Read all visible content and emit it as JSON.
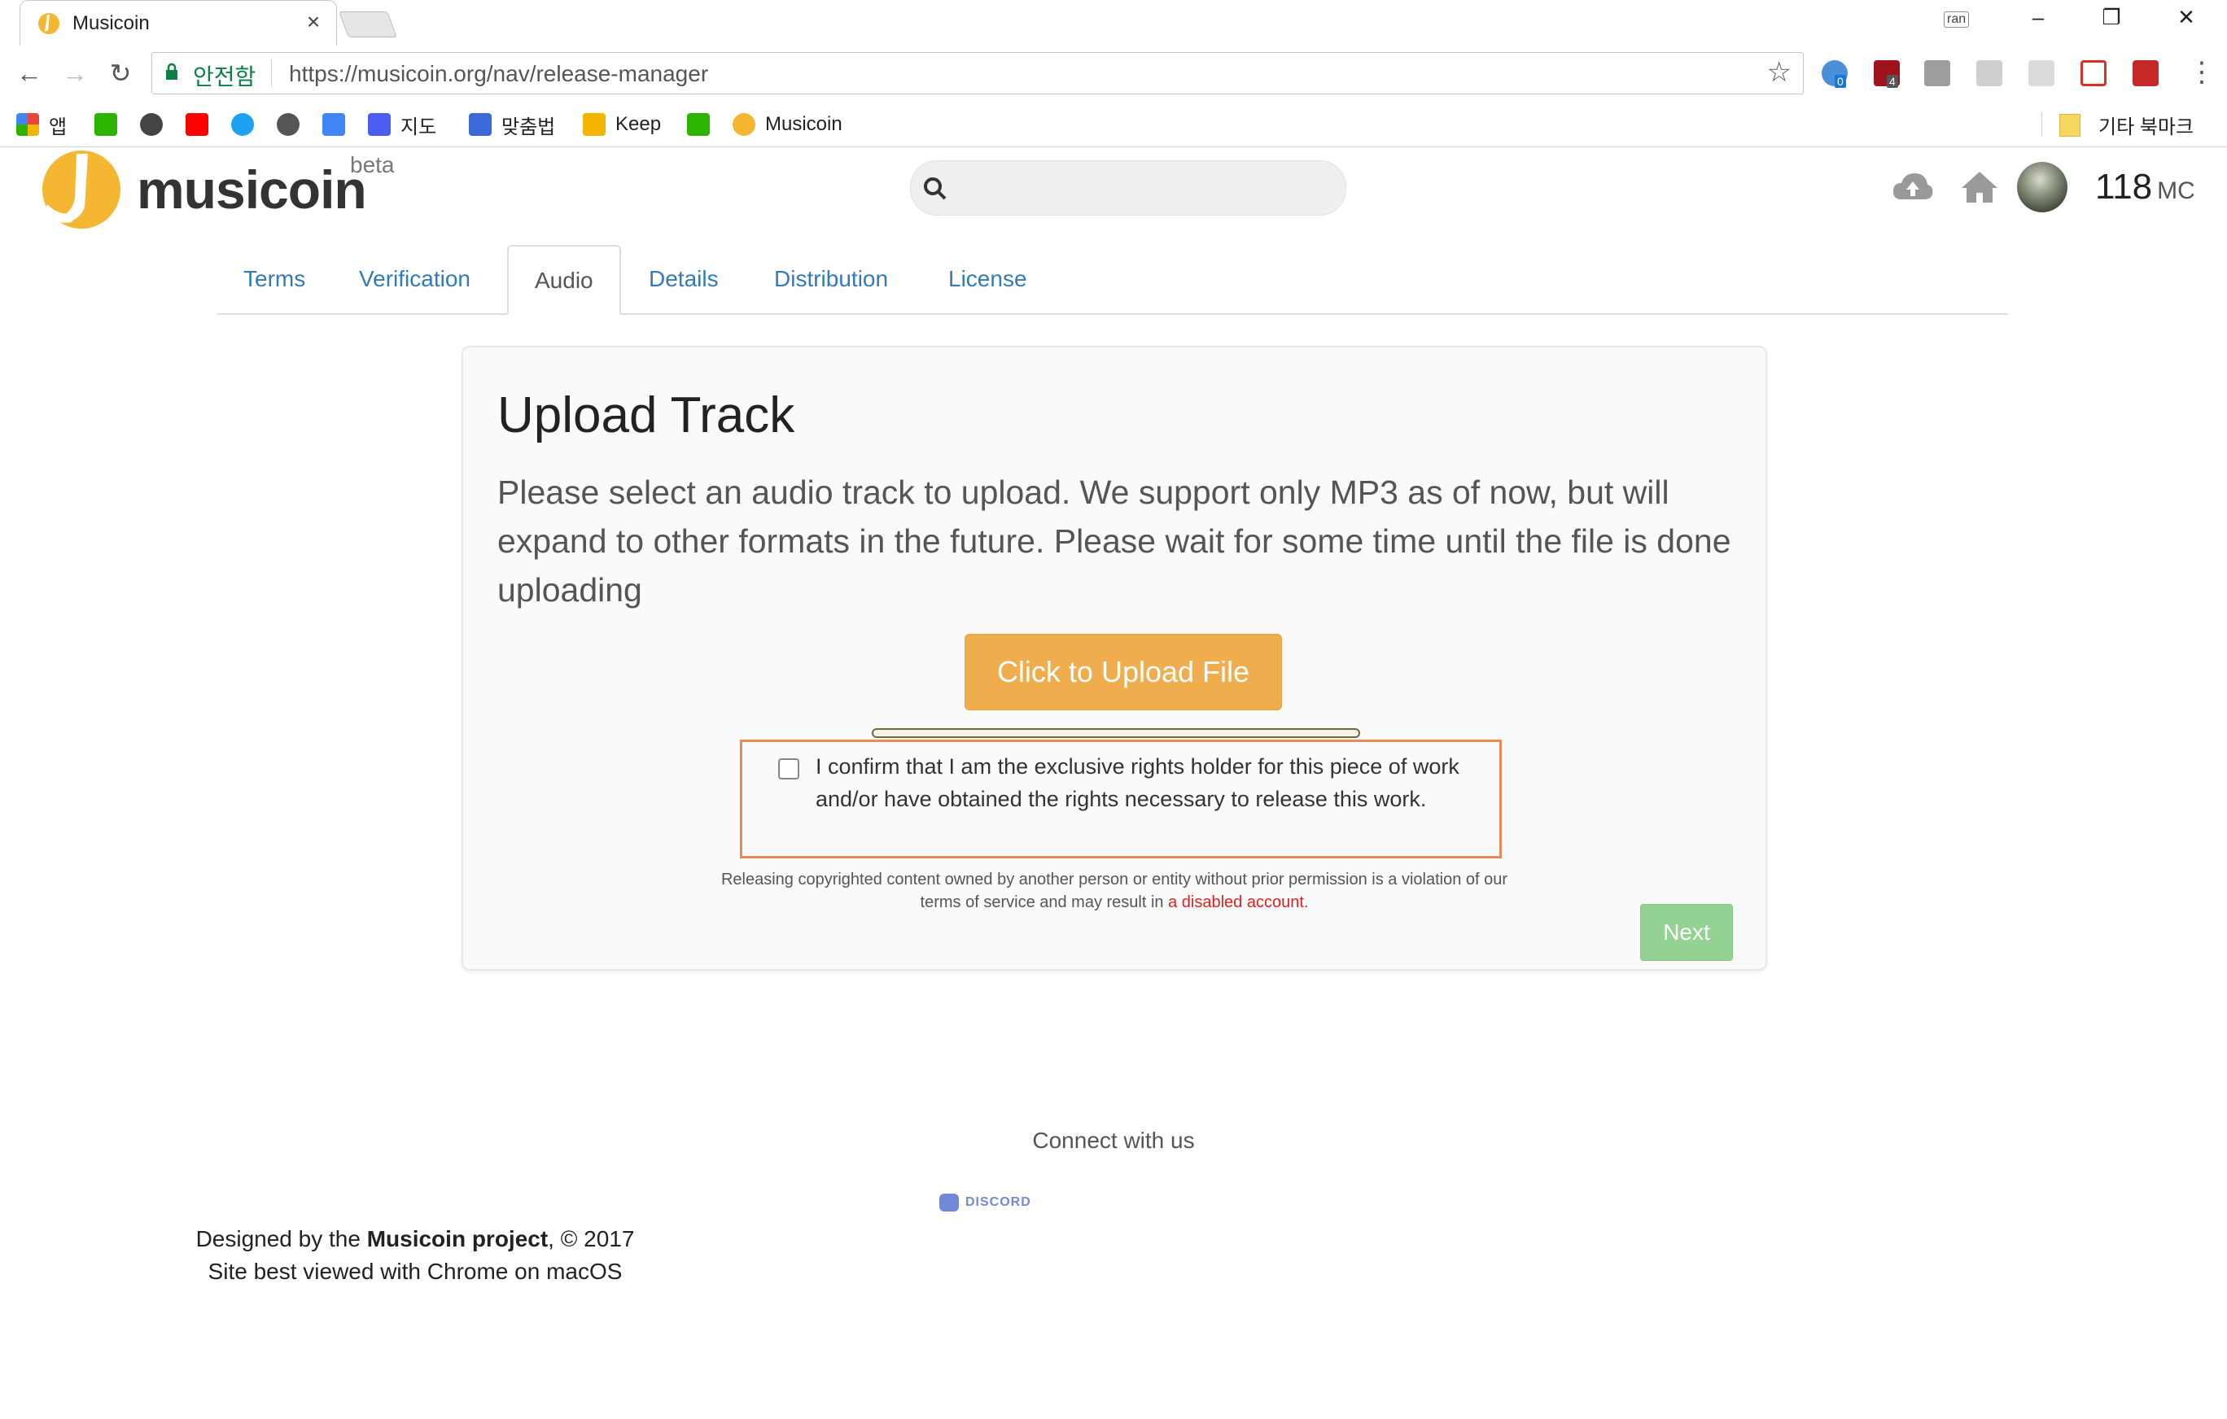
{
  "browser": {
    "tab_title": "Musicoin",
    "tab_close": "×",
    "user_chip": "ran",
    "win_min": "–",
    "win_max": "❐",
    "win_close": "✕",
    "secure_label": "안전함",
    "url": "https://musicoin.org/nav/release-manager",
    "bookmarks": [
      {
        "label": "앱",
        "icon_color": "#e8453c"
      },
      {
        "label": "",
        "icon_color": "#2db400"
      },
      {
        "label": "",
        "icon_color": "#444444"
      },
      {
        "label": "",
        "icon_color": "#ff0000"
      },
      {
        "label": "",
        "icon_color": "#1da1f2"
      },
      {
        "label": "",
        "icon_color": "#555555"
      },
      {
        "label": "",
        "icon_color": "#4285f4"
      },
      {
        "label": "지도",
        "icon_color": "#4c5cf0"
      },
      {
        "label": "맞춤법",
        "icon_color": "#3b6ad8"
      },
      {
        "label": "Keep",
        "icon_color": "#f5b400"
      },
      {
        "label": "",
        "icon_color": "#2db400"
      },
      {
        "label": "Musicoin",
        "icon_color": "#f5b731"
      }
    ],
    "other_bookmarks": "기타 북마크",
    "ext_badges": [
      "0",
      "4"
    ]
  },
  "header": {
    "logo_text": "musicoin",
    "beta": "beta",
    "search_placeholder": "",
    "balance": "118",
    "balance_unit": "MC"
  },
  "tabs": [
    "Terms",
    "Verification",
    "Audio",
    "Details",
    "Distribution",
    "License"
  ],
  "active_tab": "Audio",
  "card": {
    "title": "Upload Track",
    "description": "Please select an audio track to upload. We support only MP3 as of now, but will expand to other formats in the future. Please wait for some time until the file is done uploading",
    "upload_button": "Click to Upload File",
    "progress": 0,
    "confirm_text": "I confirm that I am the exclusive rights holder for this piece of work and/or have obtained the rights necessary to release this work.",
    "confirm_checked": false,
    "legal_text": "Releasing copyrighted content owned by another person or entity without prior permission is a violation of our terms of service and may result in",
    "legal_warning": "a disabled account.",
    "next_button": "Next"
  },
  "footer": {
    "connect": "Connect with us",
    "discord": "DISCORD",
    "designed_prefix": "Designed by the",
    "project": "Musicoin project",
    "copyright": ", © 2017",
    "best_viewed": "Site best viewed with Chrome on macOS"
  },
  "colors": {
    "accent_orange": "#f0ad4e",
    "next_green": "#93d293",
    "link_blue": "#337ab7",
    "secure_green": "#0b8043",
    "warning_red": "#e02020",
    "confirm_border": "#ec8a55"
  },
  "icons": [
    "musicoin-icon",
    "search-icon",
    "cloud-upload-icon",
    "home-icon",
    "lock-icon",
    "star-icon",
    "back-icon",
    "forward-icon",
    "reload-icon",
    "discord-icon"
  ]
}
